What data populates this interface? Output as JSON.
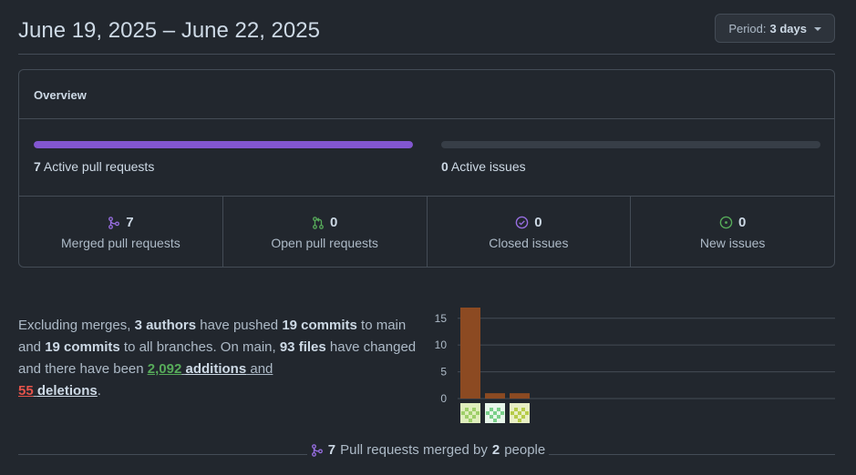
{
  "header": {
    "date_range": "June 19, 2025 – June 22, 2025",
    "period_label": "Period:",
    "period_value": "3 days"
  },
  "overview": {
    "title": "Overview",
    "active_prs": {
      "count": "7",
      "label": "Active pull requests",
      "fill_fraction": 1.0
    },
    "active_issues": {
      "count": "0",
      "label": "Active issues",
      "fill_fraction": 0.0
    },
    "stats": [
      {
        "icon": "git-merge-icon",
        "count": "7",
        "label": "Merged pull requests",
        "color": "#986ee2"
      },
      {
        "icon": "git-pull-request-icon",
        "count": "0",
        "label": "Open pull requests",
        "color": "#57ab5a"
      },
      {
        "icon": "issue-closed-icon",
        "count": "0",
        "label": "Closed issues",
        "color": "#986ee2"
      },
      {
        "icon": "issue-opened-icon",
        "count": "0",
        "label": "New issues",
        "color": "#57ab5a"
      }
    ]
  },
  "summary": {
    "t1": "Excluding merges, ",
    "authors": "3 authors",
    "t2": " have pushed ",
    "commits_main": "19 commits",
    "t3": " to main and ",
    "commits_all": "19 commits",
    "t4": " to all branches. On main, ",
    "files": "93 files",
    "t5": " have changed and there have been ",
    "additions_num": "2,092",
    "additions_word": "additions",
    "t6": " and",
    "deletions_num": "55",
    "deletions_word": "deletions",
    "t7": "."
  },
  "chart_data": {
    "type": "bar",
    "categories": [
      "author-1",
      "author-2",
      "author-3"
    ],
    "values": [
      17,
      1,
      1
    ],
    "yticks": [
      "0",
      "5",
      "10",
      "15"
    ],
    "ylim": [
      0,
      17
    ],
    "bar_color": "#8c4a22",
    "grid": true
  },
  "footer": {
    "count": "7",
    "t1": "Pull requests merged by",
    "people": "2",
    "t2": "people"
  }
}
